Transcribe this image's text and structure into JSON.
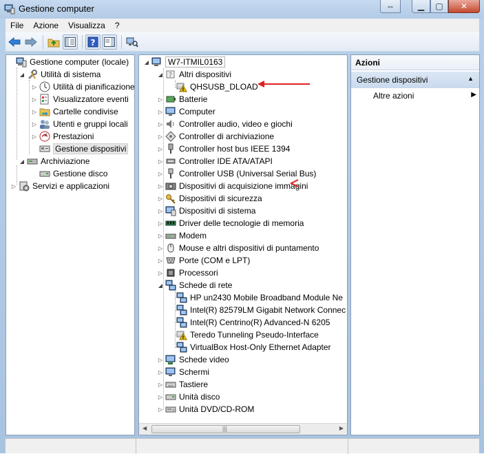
{
  "window": {
    "title": "Gestione computer"
  },
  "menu": [
    "File",
    "Azione",
    "Visualizza",
    "?"
  ],
  "left_tree": [
    {
      "label": "Gestione computer (locale)",
      "icon": "computer-mgmt-icon"
    },
    {
      "label": "Utilità di sistema",
      "icon": "tools-icon"
    },
    {
      "label": "Utilità di pianificazione",
      "icon": "clock-icon"
    },
    {
      "label": "Visualizzatore eventi",
      "icon": "event-viewer-icon"
    },
    {
      "label": "Cartelle condivise",
      "icon": "shared-folder-icon"
    },
    {
      "label": "Utenti e gruppi locali",
      "icon": "users-icon"
    },
    {
      "label": "Prestazioni",
      "icon": "performance-icon"
    },
    {
      "label": "Gestione dispositivi",
      "icon": "device-manager-icon"
    },
    {
      "label": "Archiviazione",
      "icon": "storage-icon"
    },
    {
      "label": "Gestione disco",
      "icon": "disk-icon"
    },
    {
      "label": "Servizi e applicazioni",
      "icon": "services-icon"
    }
  ],
  "device_tree": {
    "root": "W7-ITMIL0163",
    "items": [
      {
        "label": "Altri dispositivi",
        "icon": "unknown-device-icon"
      },
      {
        "label": "QHSUSB_DLOAD",
        "icon": "warning-icon"
      },
      {
        "label": "Batterie",
        "icon": "battery-icon"
      },
      {
        "label": "Computer",
        "icon": "monitor-icon"
      },
      {
        "label": "Controller audio, video e giochi",
        "icon": "speaker-icon"
      },
      {
        "label": "Controller di archiviazione",
        "icon": "storage-controller-icon"
      },
      {
        "label": "Controller host bus IEEE 1394",
        "icon": "firewire-icon"
      },
      {
        "label": "Controller IDE ATA/ATAPI",
        "icon": "ide-icon"
      },
      {
        "label": "Controller USB (Universal Serial Bus)",
        "icon": "usb-icon"
      },
      {
        "label": "Dispositivi di acquisizione immagini",
        "icon": "camera-icon"
      },
      {
        "label": "Dispositivi di sicurezza",
        "icon": "key-icon"
      },
      {
        "label": "Dispositivi di sistema",
        "icon": "system-device-icon"
      },
      {
        "label": "Driver delle tecnologie di memoria",
        "icon": "memory-icon"
      },
      {
        "label": "Modem",
        "icon": "modem-icon"
      },
      {
        "label": "Mouse e altri dispositivi di puntamento",
        "icon": "mouse-icon"
      },
      {
        "label": "Porte (COM e LPT)",
        "icon": "port-icon"
      },
      {
        "label": "Processori",
        "icon": "cpu-icon"
      },
      {
        "label": "Schede di rete",
        "icon": "network-icon"
      },
      {
        "label": "HP un2430 Mobile Broadband Module Ne",
        "icon": "network-icon"
      },
      {
        "label": "Intel(R) 82579LM Gigabit Network Connec",
        "icon": "network-icon"
      },
      {
        "label": "Intel(R) Centrino(R) Advanced-N 6205",
        "icon": "network-icon"
      },
      {
        "label": "Teredo Tunneling Pseudo-Interface",
        "icon": "warning-icon"
      },
      {
        "label": "VirtualBox Host-Only Ethernet Adapter",
        "icon": "network-icon"
      },
      {
        "label": "Schede video",
        "icon": "display-adapter-icon"
      },
      {
        "label": "Schermi",
        "icon": "monitor-icon"
      },
      {
        "label": "Tastiere",
        "icon": "keyboard-icon"
      },
      {
        "label": "Unità disco",
        "icon": "disk-drive-icon"
      },
      {
        "label": "Unità DVD/CD-ROM",
        "icon": "dvd-icon"
      }
    ]
  },
  "actions": {
    "header": "Azioni",
    "selected": "Gestione dispositivi",
    "item": "Altre azioni"
  },
  "colors": {
    "annotation_arrow": "#e02020",
    "warning": "#f0c000"
  }
}
